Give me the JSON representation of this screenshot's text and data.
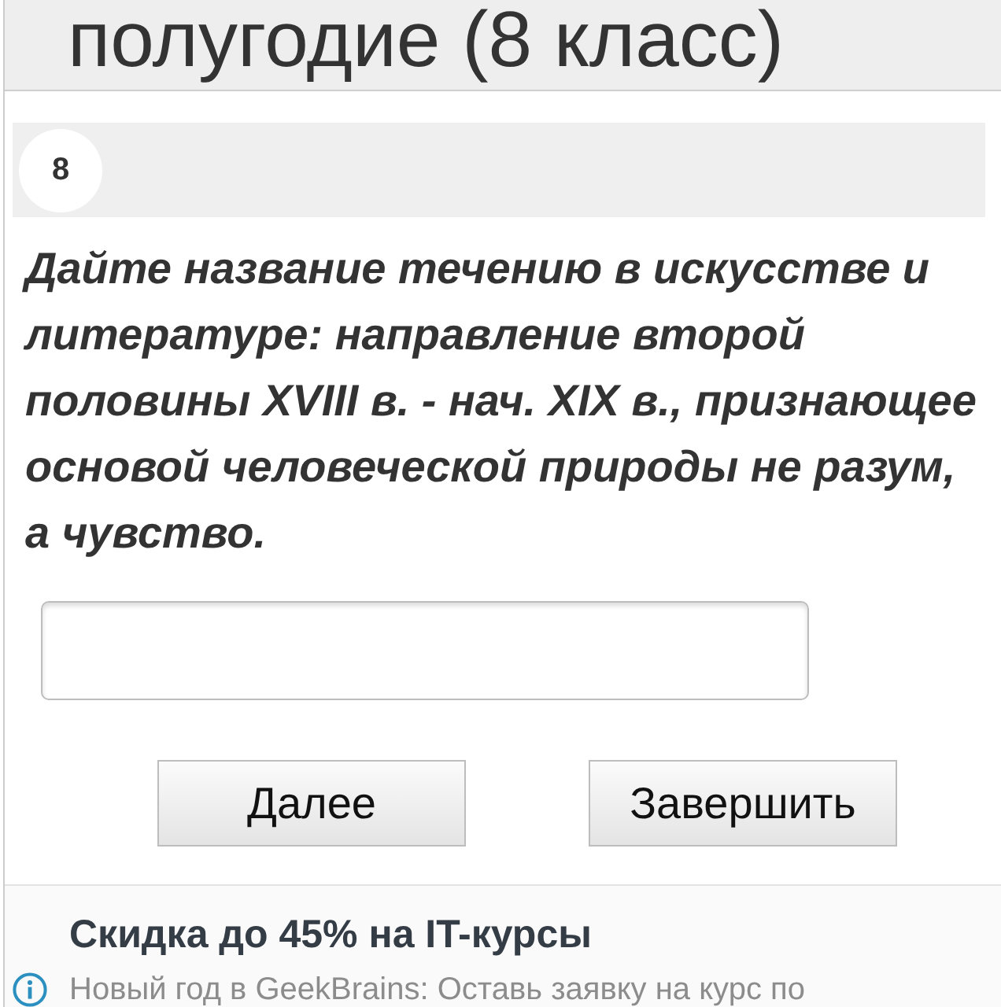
{
  "page": {
    "title": "полугодие (8 класс)"
  },
  "question": {
    "number": "8",
    "text": "Дайте название течению в искусстве и литературе: направление второй половины XVIII в. - нач. XIX в., признающее основой человеческой природы не разум, а чувство."
  },
  "buttons": [
    {
      "label": "Далее"
    },
    {
      "label": "Завершить"
    }
  ],
  "ad": {
    "title": "Скидка до 45% на IT-курсы",
    "text": "Новый год в GeekBrains: Оставь заявку на курс по"
  }
}
